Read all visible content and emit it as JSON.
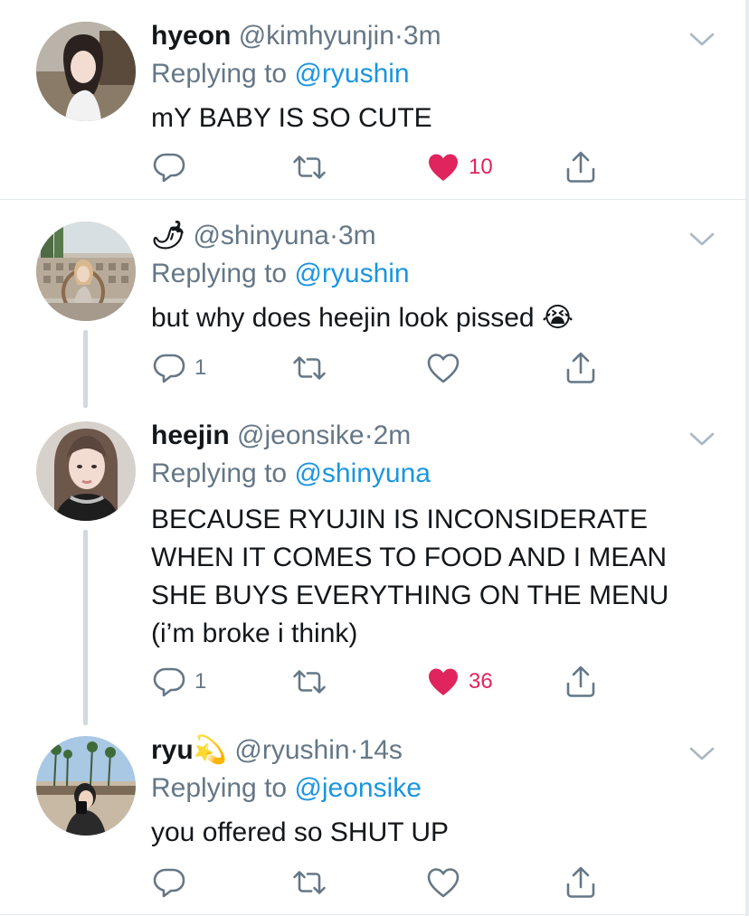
{
  "colors": {
    "accent": "#1b95e0",
    "like": "#e0245e",
    "muted": "#657786",
    "text": "#14171a"
  },
  "tweets": [
    {
      "name": "hyeon",
      "handle": "@kimhyunjin",
      "dot": "·",
      "time": "3m",
      "replying_label": "Replying to ",
      "replying_to": "@ryushin",
      "body": "mY BABY IS SO CUTE",
      "reply_count": "",
      "like_count": "10",
      "liked": true,
      "avatar_icon": "avatar-photo"
    },
    {
      "name": "🌶",
      "handle": "@shinyuna",
      "dot": "·",
      "time": "3m",
      "replying_label": "Replying to ",
      "replying_to": "@ryushin",
      "body": "but why does heejin look pissed 😭",
      "reply_count": "1",
      "like_count": "",
      "liked": false,
      "avatar_icon": "avatar-photo"
    },
    {
      "name": "heejin",
      "handle": "@jeonsike",
      "dot": "·",
      "time": "2m",
      "replying_label": "Replying to ",
      "replying_to": "@shinyuna",
      "body": "BECAUSE RYUJIN IS INCONSIDERATE\nWHEN IT COMES TO FOOD AND I MEAN\nSHE BUYS EVERYTHING ON THE MENU\n(i’m broke i think)",
      "reply_count": "1",
      "like_count": "36",
      "liked": true,
      "avatar_icon": "avatar-photo"
    },
    {
      "name": "ryu💫",
      "handle": "@ryushin",
      "dot": "·",
      "time": "14s",
      "replying_label": "Replying to ",
      "replying_to": "@jeonsike",
      "body": "you offered so SHUT UP",
      "reply_count": "",
      "like_count": "",
      "liked": false,
      "avatar_icon": "avatar-photo"
    }
  ]
}
